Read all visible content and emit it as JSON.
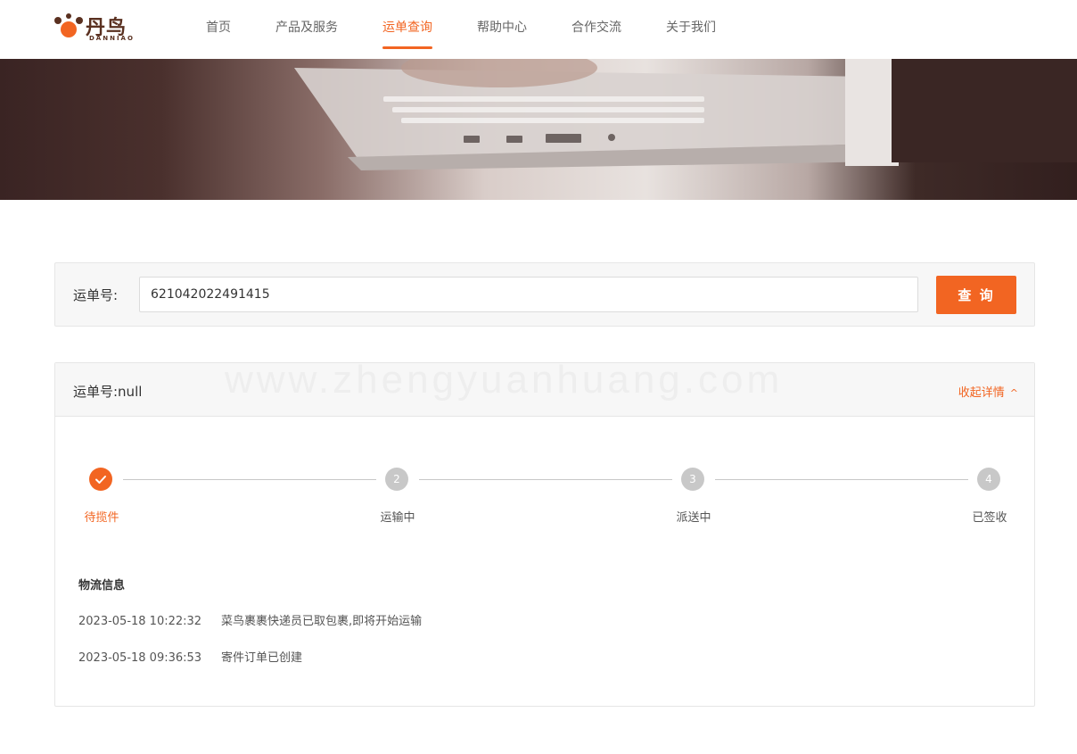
{
  "brand": {
    "name_cn": "丹鸟",
    "name_en": "DANNIAO",
    "color": "#f26522"
  },
  "nav": {
    "items": [
      {
        "label": "首页"
      },
      {
        "label": "产品及服务"
      },
      {
        "label": "运单查询",
        "active": true
      },
      {
        "label": "帮助中心"
      },
      {
        "label": "合作交流"
      },
      {
        "label": "关于我们"
      }
    ]
  },
  "search": {
    "label": "运单号:",
    "value": "621042022491415",
    "button": "查 询"
  },
  "detail": {
    "watermark": "www.zhengyuanhuang.com",
    "order_label": "运单号:null",
    "collapse_label": "收起详情",
    "steps": [
      {
        "label": "待揽件",
        "number": "",
        "state": "done"
      },
      {
        "label": "运输中",
        "number": "2",
        "state": "pending"
      },
      {
        "label": "派送中",
        "number": "3",
        "state": "pending"
      },
      {
        "label": "已签收",
        "number": "4",
        "state": "pending"
      }
    ],
    "logistics": {
      "title": "物流信息",
      "records": [
        {
          "time": "2023-05-18 10:22:32",
          "text": "菜鸟裹裹快递员已取包裹,即将开始运输"
        },
        {
          "time": "2023-05-18 09:36:53",
          "text": "寄件订单已创建"
        }
      ]
    }
  }
}
